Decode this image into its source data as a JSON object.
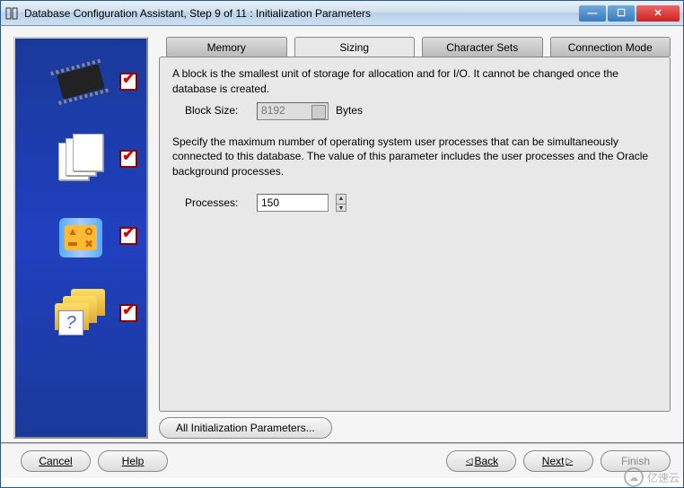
{
  "window": {
    "title": "Database Configuration Assistant, Step 9 of 11 : Initialization Parameters"
  },
  "tabs": {
    "memory": "Memory",
    "sizing": "Sizing",
    "charsets": "Character Sets",
    "connmode": "Connection Mode"
  },
  "sizing": {
    "block_desc": "A block is the smallest unit of storage for allocation and for I/O. It cannot be changed once the database is created.",
    "block_size_label": "Block Size:",
    "block_size_value": "8192",
    "block_size_unit": "Bytes",
    "processes_desc": "Specify the maximum number of operating system user processes that can be simultaneously connected to this database. The value of this parameter includes the user processes and the Oracle background processes.",
    "processes_label": "Processes:",
    "processes_value": "150"
  },
  "all_params_button": "All Initialization Parameters...",
  "footer": {
    "cancel": "Cancel",
    "help": "Help",
    "back": "Back",
    "next": "Next",
    "finish": "Finish"
  },
  "watermark": "亿速云"
}
